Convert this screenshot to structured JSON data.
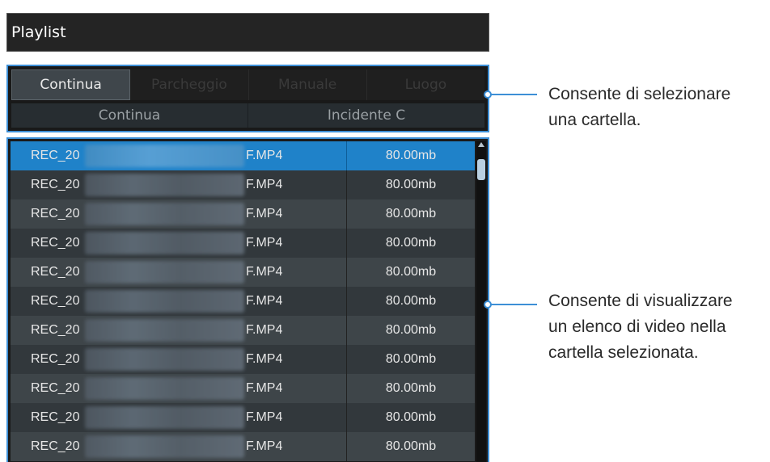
{
  "playlist": {
    "title": "Playlist",
    "tabs": [
      {
        "label": "Continua"
      },
      {
        "label": "Parcheggio"
      },
      {
        "label": "Manuale"
      },
      {
        "label": "Luogo"
      }
    ],
    "subtabs": [
      {
        "label": "Continua"
      },
      {
        "label": "Incidente C"
      }
    ],
    "files": [
      {
        "name_start": "REC_20",
        "name_end": "F.MP4",
        "size": "80.00mb"
      },
      {
        "name_start": "REC_20",
        "name_end": "F.MP4",
        "size": "80.00mb"
      },
      {
        "name_start": "REC_20",
        "name_end": "F.MP4",
        "size": "80.00mb"
      },
      {
        "name_start": "REC_20",
        "name_end": "F.MP4",
        "size": "80.00mb"
      },
      {
        "name_start": "REC_20",
        "name_end": "F.MP4",
        "size": "80.00mb"
      },
      {
        "name_start": "REC_20",
        "name_end": "F.MP4",
        "size": "80.00mb"
      },
      {
        "name_start": "REC_20",
        "name_end": "F.MP4",
        "size": "80.00mb"
      },
      {
        "name_start": "REC_20",
        "name_end": "F.MP4",
        "size": "80.00mb"
      },
      {
        "name_start": "REC_20",
        "name_end": "F.MP4",
        "size": "80.00mb"
      },
      {
        "name_start": "REC_20",
        "name_end": "F.MP4",
        "size": "80.00mb"
      },
      {
        "name_start": "REC_20",
        "name_end": "F.MP4",
        "size": "80.00mb"
      }
    ]
  },
  "callouts": {
    "folder_line1": "Consente di selezionare",
    "folder_line2": "una cartella.",
    "list_line1": "Consente di visualizzare",
    "list_line2": "un elenco di video nella",
    "list_line3": "cartella selezionata."
  },
  "colors": {
    "accent": "#3d8fd6",
    "selected_row": "#1f82c9"
  }
}
